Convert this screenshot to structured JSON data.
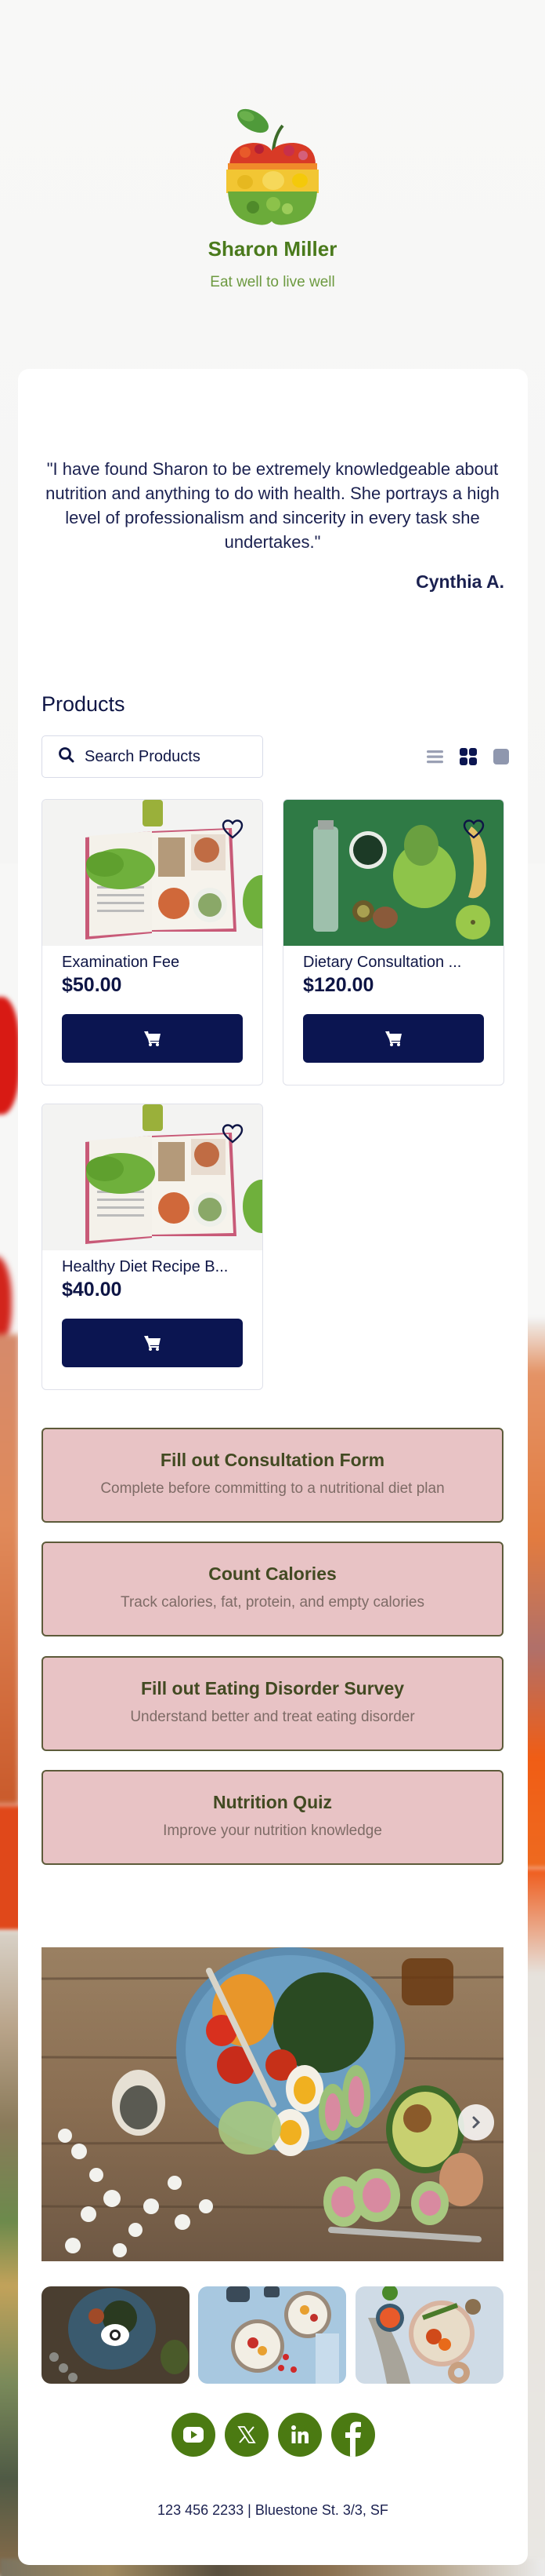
{
  "brand": {
    "name": "Sharon Miller",
    "tagline": "Eat well to live well",
    "logo_icon": "apple-of-vegetables-icon"
  },
  "testimonial": {
    "quote": "\"I have found Sharon to be extremely knowledgeable about nutrition and anything to do with health.  She portrays a high level of professionalism and sincerity in every task she undertakes.\"",
    "author": "Cynthia A."
  },
  "products": {
    "title": "Products",
    "search_placeholder": "Search Products",
    "view_modes": [
      {
        "name": "list-view",
        "active": false
      },
      {
        "name": "grid-view",
        "active": true
      },
      {
        "name": "single-view",
        "active": false
      }
    ],
    "items": [
      {
        "name": "Examination Fee",
        "price": "$50.00",
        "image": "recipe-book-with-lettuce"
      },
      {
        "name": "Dietary Consultation ...",
        "price": "$120.00",
        "image": "green-table-bottle-lettuce-banana"
      },
      {
        "name": "Healthy Diet Recipe B...",
        "price": "$40.00",
        "image": "recipe-book-with-lettuce"
      }
    ]
  },
  "actions": [
    {
      "title": "Fill out Consultation Form",
      "subtitle": "Complete before committing to a nutritional diet plan"
    },
    {
      "title": "Count Calories",
      "subtitle": "Track calories, fat, protein, and empty calories"
    },
    {
      "title": "Fill out Eating Disorder Survey",
      "subtitle": "Understand better and treat eating disorder"
    },
    {
      "title": "Nutrition Quiz",
      "subtitle": "Improve your nutrition knowledge"
    }
  ],
  "gallery": {
    "main_image": "salad-bowl-on-wooden-table",
    "thumbnails": [
      {
        "image": "salad-bowl-on-wooden-table",
        "selected": true
      },
      {
        "image": "yogurt-bowls-with-berries",
        "selected": false
      },
      {
        "image": "grain-bowl-with-vegetables",
        "selected": false
      }
    ]
  },
  "socials": [
    {
      "name": "youtube"
    },
    {
      "name": "x"
    },
    {
      "name": "linkedin"
    },
    {
      "name": "facebook"
    }
  ],
  "footer": {
    "contact": "123 456 2233 | Bluestone St. 3/3, SF"
  },
  "colors": {
    "brand_green": "#4a7a1c",
    "navy": "#0b1551",
    "action_pink": "#e8c3c5",
    "action_border": "#5d5b3a",
    "social_green": "#4b7a12"
  }
}
